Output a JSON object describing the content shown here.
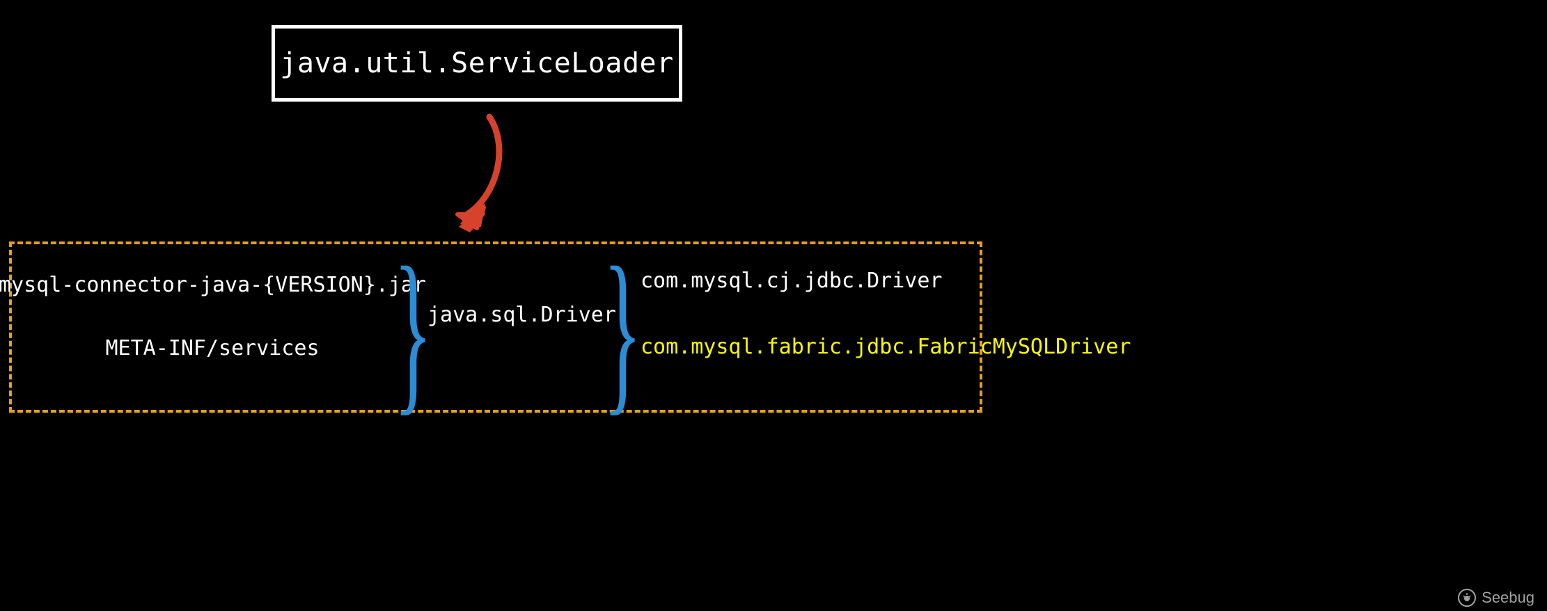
{
  "top": {
    "title": "java.util.ServiceLoader"
  },
  "left": {
    "jar": "mysql-connector-java-{VERSION}.jar",
    "metainf": "META-INF/services"
  },
  "mid": {
    "iface": "java.sql.Driver"
  },
  "right": {
    "driver1": "com.mysql.cj.jdbc.Driver",
    "driver2": "com.mysql.fabric.jdbc.FabricMySQLDriver"
  },
  "watermark": {
    "text": "Seebug"
  },
  "colors": {
    "arrow": "#d6432a",
    "brace": "#2a8dd6",
    "dash": "#e6a014",
    "highlight": "#f9f900"
  }
}
